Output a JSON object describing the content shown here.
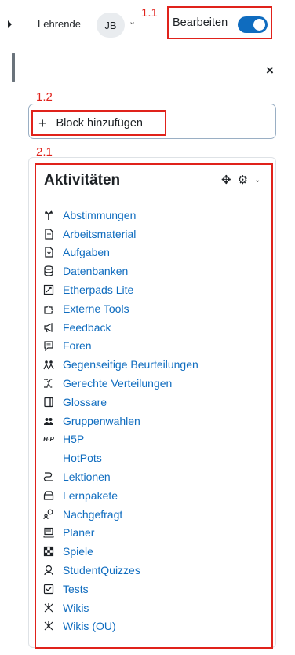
{
  "topbar": {
    "role_label": "Lehrende",
    "avatar_initials": "JB",
    "edit_mode_label": "Bearbeiten",
    "edit_mode_on": true
  },
  "annotations": {
    "edit_mode": "1.1",
    "add_block": "1.2",
    "activities_block": "2.1"
  },
  "drawer": {
    "close_symbol": "×",
    "add_block_label": "Block hinzufügen"
  },
  "activities_block": {
    "title": "Aktivitäten",
    "items": [
      {
        "label": "Abstimmungen",
        "icon": "choice-icon"
      },
      {
        "label": "Arbeitsmaterial",
        "icon": "resource-icon"
      },
      {
        "label": "Aufgaben",
        "icon": "assignment-icon"
      },
      {
        "label": "Datenbanken",
        "icon": "database-icon"
      },
      {
        "label": "Etherpads Lite",
        "icon": "etherpad-icon"
      },
      {
        "label": "Externe Tools",
        "icon": "puzzle-icon"
      },
      {
        "label": "Feedback",
        "icon": "megaphone-icon"
      },
      {
        "label": "Foren",
        "icon": "forum-icon"
      },
      {
        "label": "Gegenseitige Beurteilungen",
        "icon": "workshop-icon"
      },
      {
        "label": "Gerechte Verteilungen",
        "icon": "allocation-icon"
      },
      {
        "label": "Glossare",
        "icon": "glossary-icon"
      },
      {
        "label": "Gruppenwahlen",
        "icon": "group-icon"
      },
      {
        "label": "H5P",
        "icon": "h5p-icon"
      },
      {
        "label": "HotPots",
        "icon": ""
      },
      {
        "label": "Lektionen",
        "icon": "lesson-icon"
      },
      {
        "label": "Lernpakete",
        "icon": "package-icon"
      },
      {
        "label": "Nachgefragt",
        "icon": "questionnaire-icon"
      },
      {
        "label": "Planer",
        "icon": "scheduler-icon"
      },
      {
        "label": "Spiele",
        "icon": "game-icon"
      },
      {
        "label": "StudentQuizzes",
        "icon": "studentquiz-icon"
      },
      {
        "label": "Tests",
        "icon": "quiz-icon"
      },
      {
        "label": "Wikis",
        "icon": "wiki-icon"
      },
      {
        "label": "Wikis (OU)",
        "icon": "wiki-ou-icon"
      }
    ]
  },
  "colors": {
    "link": "#0f6cbf",
    "toggle_on": "#0f6cbf",
    "annotation_red": "#e0221b"
  }
}
